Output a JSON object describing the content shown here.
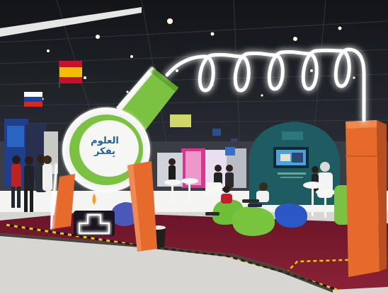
{
  "scene": {
    "booth_logo_text": "العلوم بِفكر"
  },
  "colors": {
    "ceiling": "#1a1d22",
    "carpet": "#7a1a2e",
    "floor": "#d8d6d2",
    "flask_green": "#7cc242",
    "flask_white": "#f3f3f1",
    "orange_panel": "#e56a2c",
    "teal_booth": "#1d5d62",
    "blue_bean_bag": "#2a59c6",
    "neon": "#ffffff"
  },
  "icons": [
    "flask-sculpture",
    "neon-coil",
    "spain-flag",
    "russia-flag",
    "lamp-icon",
    "bean-bag"
  ]
}
